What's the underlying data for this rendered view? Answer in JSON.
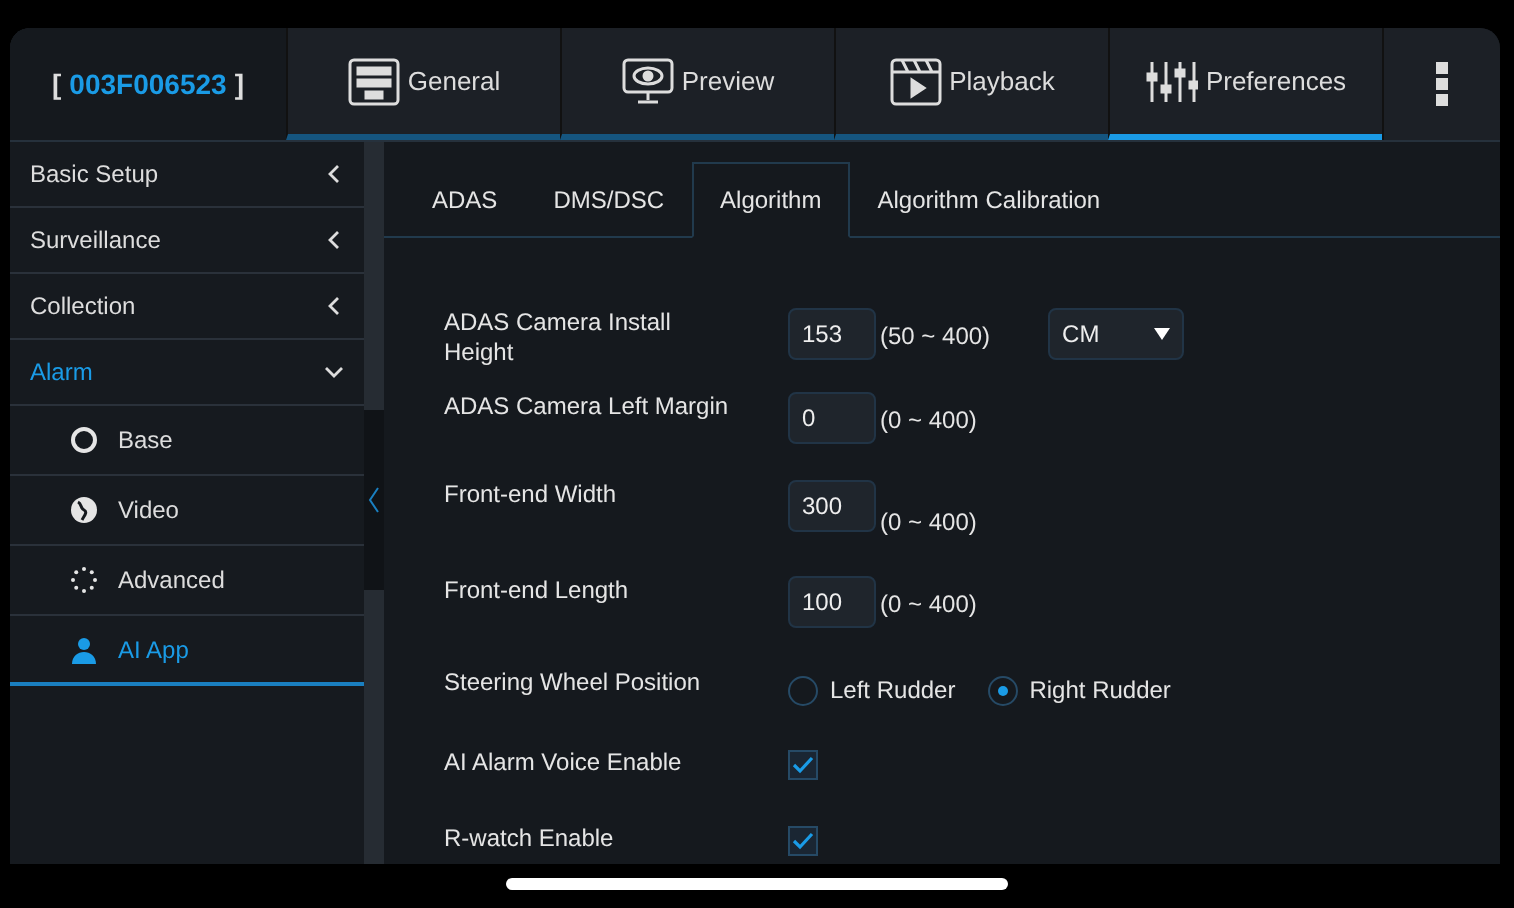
{
  "device_id": {
    "open": "[",
    "id": "003F006523",
    "close": "]"
  },
  "nav_tabs": [
    {
      "label": "General",
      "selected": false
    },
    {
      "label": "Preview",
      "selected": false
    },
    {
      "label": "Playback",
      "selected": false
    },
    {
      "label": "Preferences",
      "selected": true
    }
  ],
  "sidebar": {
    "items": [
      {
        "label": "Basic Setup",
        "expanded": false,
        "selected": false
      },
      {
        "label": "Surveillance",
        "expanded": false,
        "selected": false
      },
      {
        "label": "Collection",
        "expanded": false,
        "selected": false
      },
      {
        "label": "Alarm",
        "expanded": true,
        "selected": true,
        "children": [
          {
            "label": "Base",
            "selected": false
          },
          {
            "label": "Video",
            "selected": false
          },
          {
            "label": "Advanced",
            "selected": false
          },
          {
            "label": "AI App",
            "selected": true
          }
        ]
      }
    ]
  },
  "sub_tabs": [
    {
      "label": "ADAS",
      "selected": false
    },
    {
      "label": "DMS/DSC",
      "selected": false
    },
    {
      "label": "Algorithm",
      "selected": true
    },
    {
      "label": "Algorithm Calibration",
      "selected": false
    }
  ],
  "form": [
    {
      "kind": "number",
      "label": "ADAS Camera Install Height",
      "value": "153",
      "range": "(50 ~ 400)",
      "unit": "CM"
    },
    {
      "kind": "number",
      "label": "ADAS Camera Left Margin",
      "value": "0",
      "range": "(0 ~ 400)"
    },
    {
      "kind": "number",
      "label": "Front-end Width",
      "value": "300",
      "range": "(0 ~ 400)"
    },
    {
      "kind": "number",
      "label": "Front-end Length",
      "value": "100",
      "range": "(0 ~ 400)"
    },
    {
      "kind": "radio",
      "label": "Steering Wheel Position",
      "options": [
        {
          "label": "Left Rudder",
          "selected": false
        },
        {
          "label": "Right Rudder",
          "selected": true
        }
      ]
    },
    {
      "kind": "checkbox",
      "label": "AI Alarm Voice Enable",
      "checked": true
    },
    {
      "kind": "checkbox",
      "label": "R-watch Enable",
      "checked": true
    }
  ]
}
